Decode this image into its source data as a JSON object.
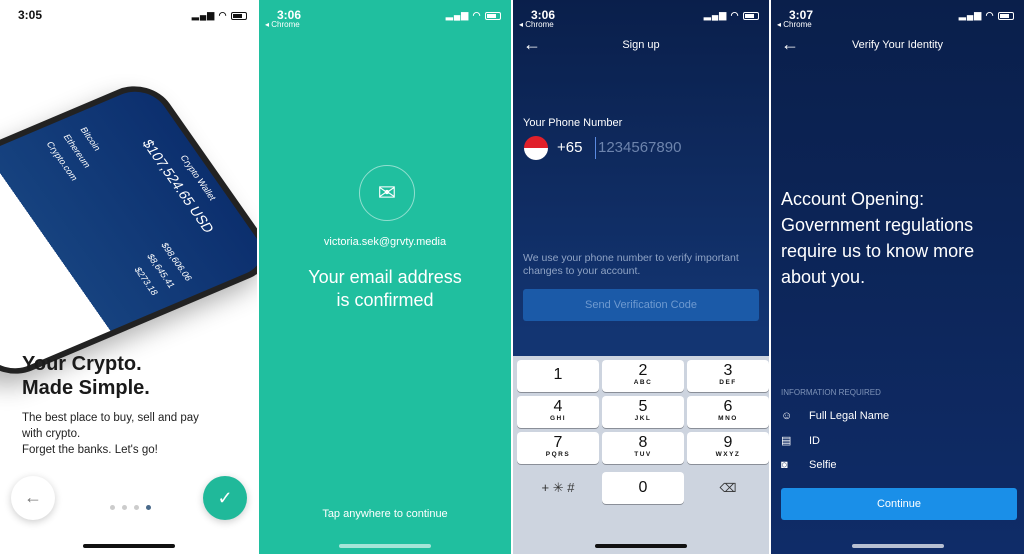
{
  "screen1": {
    "time": "3:05",
    "title_line1": "Your Crypto.",
    "title_line2": "Made Simple.",
    "body_line1": "The best place to buy, sell and pay",
    "body_line2": "with crypto.",
    "body_line3": "Forget the banks. Let's go!",
    "mockup": {
      "header": "Crypto Wallet",
      "total": "$107,524.65 USD",
      "assets": [
        "Bitcoin",
        "Ethereum",
        "Crypto.com"
      ],
      "amounts": [
        "$98,606.06",
        "$8,645.41",
        "$273.18"
      ]
    },
    "pages": 4,
    "active_page": 4,
    "accent": "#20bf9f"
  },
  "screen2": {
    "time": "3:06",
    "back_app": "◂ Chrome",
    "email": "victoria.sek@grvty.media",
    "headline_line1": "Your email address",
    "headline_line2": "is confirmed",
    "footer": "Tap anywhere to continue",
    "bg": "#20bf9f"
  },
  "screen3": {
    "time": "3:06",
    "back_app": "◂ Chrome",
    "title": "Sign up",
    "phone_label": "Your Phone Number",
    "country_code": "+65",
    "phone_placeholder": "1234567890",
    "info_line1": "We use your phone number to verify important",
    "info_line2": "changes to your account.",
    "send_button": "Send Verification Code",
    "keypad": [
      {
        "d": "1",
        "l": ""
      },
      {
        "d": "2",
        "l": "ABC"
      },
      {
        "d": "3",
        "l": "DEF"
      },
      {
        "d": "4",
        "l": "GHI"
      },
      {
        "d": "5",
        "l": "JKL"
      },
      {
        "d": "6",
        "l": "MNO"
      },
      {
        "d": "7",
        "l": "PQRS"
      },
      {
        "d": "8",
        "l": "TUV"
      },
      {
        "d": "9",
        "l": "WXYZ"
      }
    ],
    "symbols": "+ ✳ #",
    "zero": "0"
  },
  "screen4": {
    "time": "3:07",
    "back_app": "◂ Chrome",
    "title": "Verify Your Identity",
    "heading_lines": [
      "Account Opening:",
      "Government regulations",
      "require us to know more",
      "about you."
    ],
    "info_label": "INFORMATION REQUIRED",
    "items": [
      {
        "label": "Full Legal Name",
        "icon": "head-icon"
      },
      {
        "label": "ID",
        "icon": "id-card-icon"
      },
      {
        "label": "Selfie",
        "icon": "camera-icon"
      }
    ],
    "continue_button": "Continue",
    "accent": "#1a8fe8"
  }
}
